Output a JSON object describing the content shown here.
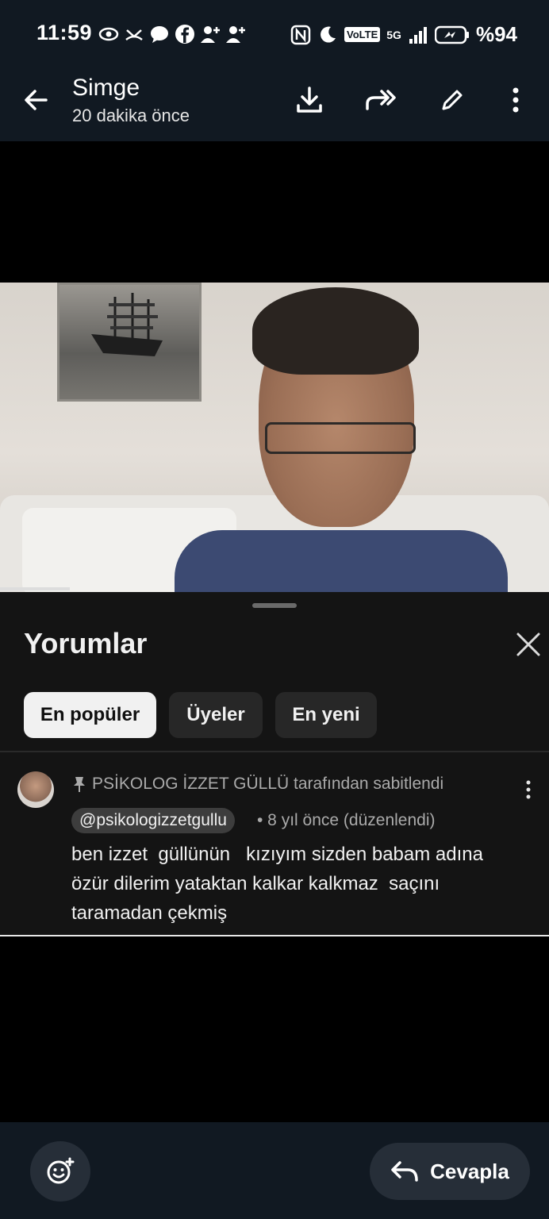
{
  "status_bar": {
    "time": "11:59",
    "battery": "%94",
    "network": "5G",
    "volte": "VoLTE"
  },
  "header": {
    "title": "Simge",
    "subtitle": "20 dakika önce"
  },
  "comments_sheet": {
    "title": "Yorumlar",
    "chips": [
      {
        "label": "En popüler",
        "active": true
      },
      {
        "label": "Üyeler",
        "active": false
      },
      {
        "label": "En yeni",
        "active": false
      }
    ],
    "comment": {
      "pinned_text": "PSİKOLOG İZZET GÜLLÜ tarafından sabitlendi",
      "author_handle": "@psikologizzetgullu",
      "time_ago": "• 8 yıl önce (düzenlendi)",
      "text": "ben izzet  güllünün   kızıyım sizden babam adına\nözür dilerim yataktan kalkar kalkmaz  saçını\ntaramadan çekmiş"
    }
  },
  "bottom_bar": {
    "reply_label": "Cevapla"
  },
  "colors": {
    "bar_bg": "#111922",
    "sheet_bg": "#141414",
    "chip_active_bg": "#f1f1f1",
    "chip_inactive_bg": "#272727"
  }
}
